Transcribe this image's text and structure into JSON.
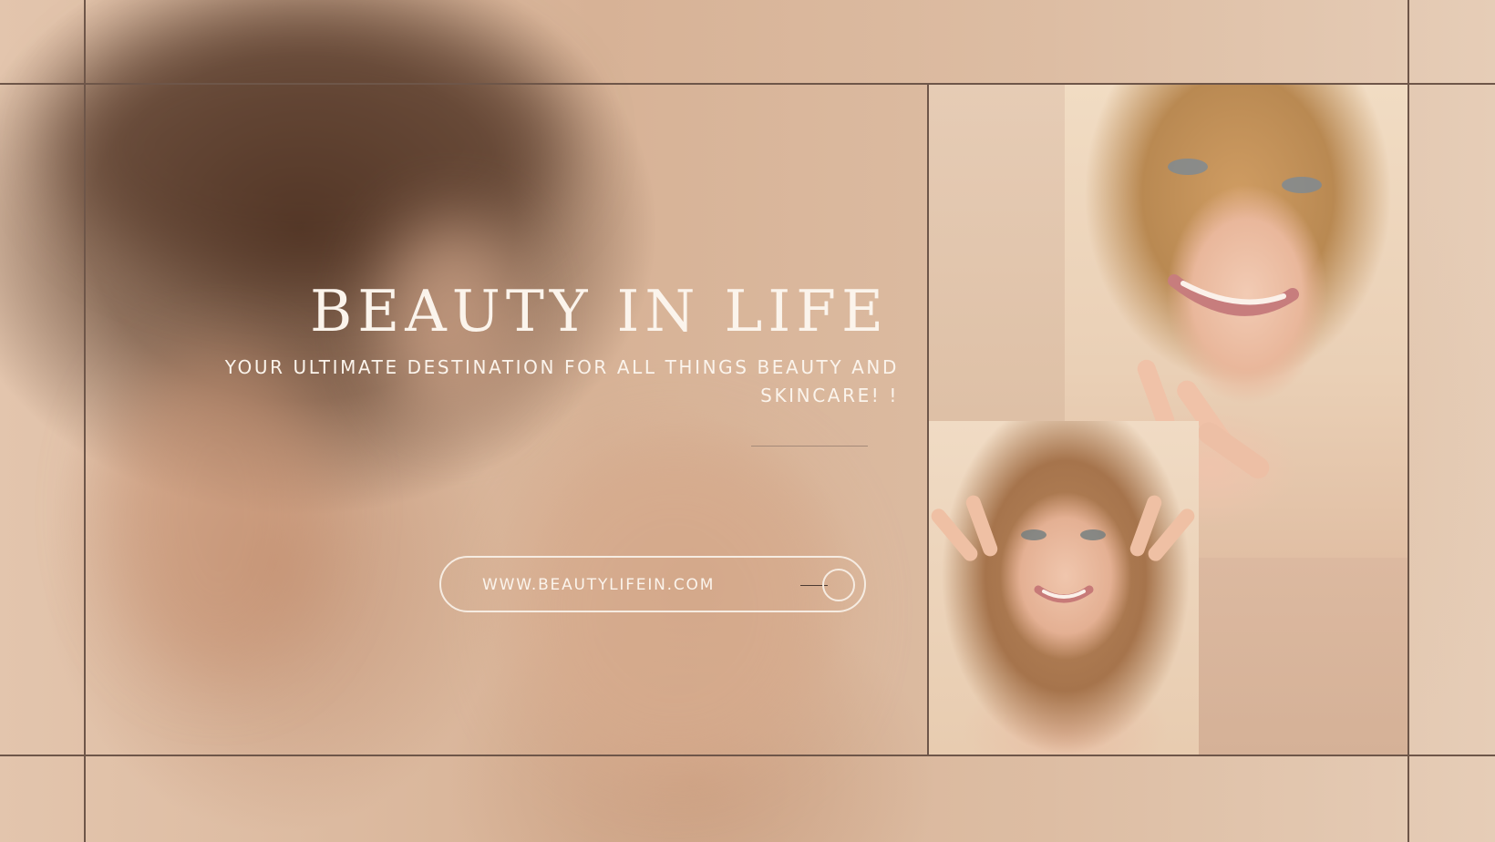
{
  "hero": {
    "title": "BEAUTY IN LIFE",
    "subtitle": "YOUR ULTIMATE DESTINATION FOR ALL THINGS BEAUTY AND SKINCARE! !",
    "url": "WWW.BEAUTYLIFEIN.COM"
  },
  "icons": {
    "arrow": "arrow-right-circle-icon"
  },
  "colors": {
    "text": "#fbf4ec",
    "grid_line": "#6e5649",
    "background": "#d9b89c"
  }
}
